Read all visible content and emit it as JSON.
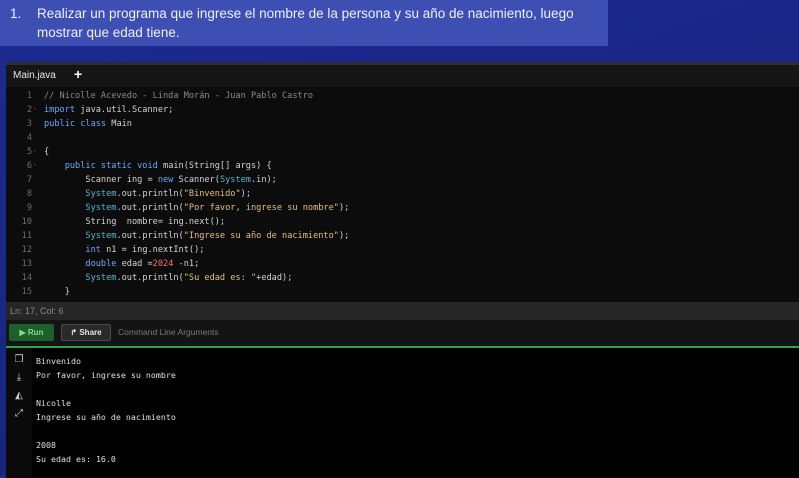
{
  "task": {
    "number": "1.",
    "text": "Realizar un programa que ingrese el nombre de la persona y su año de nacimiento, luego mostrar que edad tiene."
  },
  "editor": {
    "tab_name": "Main.java",
    "add_tab": "+",
    "status": "Ln: 17,  Col: 6"
  },
  "toolbar": {
    "run_label": "Run",
    "share_label": "Share",
    "args_placeholder": "Command Line Arguments"
  },
  "code_lines": [
    {
      "n": "1",
      "fold": ""
    },
    {
      "n": "2",
      "fold": "-"
    },
    {
      "n": "3",
      "fold": ""
    },
    {
      "n": "4",
      "fold": ""
    },
    {
      "n": "5",
      "fold": "-"
    },
    {
      "n": "6",
      "fold": "-"
    },
    {
      "n": "7",
      "fold": ""
    },
    {
      "n": "8",
      "fold": ""
    },
    {
      "n": "9",
      "fold": ""
    },
    {
      "n": "10",
      "fold": ""
    },
    {
      "n": "11",
      "fold": ""
    },
    {
      "n": "12",
      "fold": ""
    },
    {
      "n": "13",
      "fold": ""
    },
    {
      "n": "14",
      "fold": ""
    },
    {
      "n": "15",
      "fold": ""
    }
  ],
  "code": {
    "l1": "// Nicolle Acevedo - Linda Morán - Juan Pablo Castro",
    "l2_kw": "import",
    "l2_rest": " java.util.Scanner;",
    "l3_kw": "public class",
    "l3_rest": " Main",
    "l4": "",
    "l5": "{",
    "l6_a": "    ",
    "l6_kw": "public static void",
    "l6_rest": " main(String[] args) {",
    "l7_a": "        Scanner ing = ",
    "l7_kw": "new",
    "l7_b": " Scanner(",
    "l7_sys": "System",
    "l7_c": ".in);",
    "l8_a": "        ",
    "l8_sys": "System",
    "l8_b": ".out.println(",
    "l8_str": "\"Binvenido\"",
    "l8_c": ");",
    "l9_a": "        ",
    "l9_sys": "System",
    "l9_b": ".out.println(",
    "l9_str": "\"Por favor, ingrese su nombre\"",
    "l9_c": ");",
    "l10": "        String  nombre= ing.next();",
    "l11_a": "        ",
    "l11_sys": "System",
    "l11_b": ".out.println(",
    "l11_str": "\"Ingrese su año de nacimiento\"",
    "l11_c": ");",
    "l12_a": "        ",
    "l12_kw": "int",
    "l12_b": " n1 = ing.nextInt();",
    "l13_a": "        ",
    "l13_kw": "double",
    "l13_b": " edad =",
    "l13_num": "2024",
    "l13_c": " -n1;",
    "l14_a": "        ",
    "l14_sys": "System",
    "l14_b": ".out.println(",
    "l14_str": "\"Su edad es: \"",
    "l14_c": "+edad);",
    "l15": "    }"
  },
  "console": {
    "lines": [
      "Binvenido",
      "Por favor, ingrese su nombre",
      "",
      "Nicolle",
      "Ingrese su año de nacimiento",
      "",
      "2008",
      "Su edad es: 16.0"
    ]
  },
  "icons": [
    "copy-icon",
    "download-icon",
    "eraser-icon",
    "expand-icon"
  ]
}
